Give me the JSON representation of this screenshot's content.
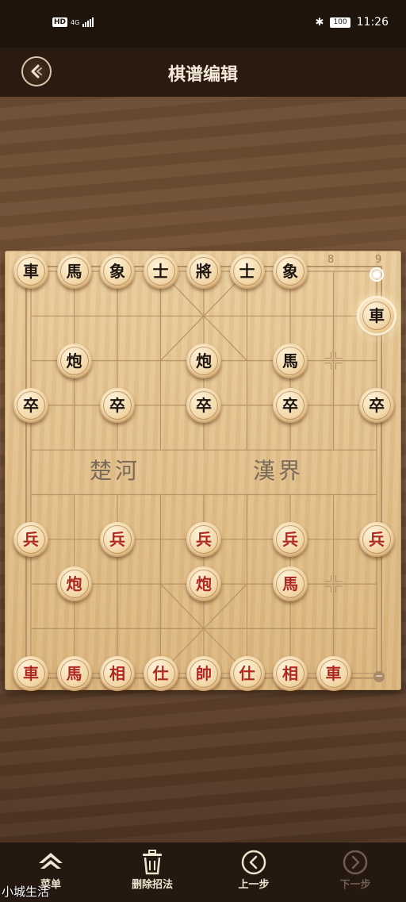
{
  "status_bar": {
    "hd": "HD",
    "network": "4G",
    "battery": "100",
    "time": "11:26"
  },
  "header": {
    "title": "棋谱编辑"
  },
  "board": {
    "file_labels": [
      "8",
      "9"
    ],
    "river_left": "楚河",
    "river_right": "漢界",
    "pieces": [
      {
        "t": "車",
        "side": "black",
        "col": 0,
        "row": 0
      },
      {
        "t": "馬",
        "side": "black",
        "col": 1,
        "row": 0
      },
      {
        "t": "象",
        "side": "black",
        "col": 2,
        "row": 0
      },
      {
        "t": "士",
        "side": "black",
        "col": 3,
        "row": 0
      },
      {
        "t": "將",
        "side": "black",
        "col": 4,
        "row": 0
      },
      {
        "t": "士",
        "side": "black",
        "col": 5,
        "row": 0
      },
      {
        "t": "象",
        "side": "black",
        "col": 6,
        "row": 0
      },
      {
        "t": "車",
        "side": "black",
        "col": 8,
        "row": 1,
        "selected": true
      },
      {
        "t": "炮",
        "side": "black",
        "col": 1,
        "row": 2
      },
      {
        "t": "炮",
        "side": "black",
        "col": 4,
        "row": 2
      },
      {
        "t": "馬",
        "side": "black",
        "col": 6,
        "row": 2
      },
      {
        "t": "卒",
        "side": "black",
        "col": 0,
        "row": 3
      },
      {
        "t": "卒",
        "side": "black",
        "col": 2,
        "row": 3
      },
      {
        "t": "卒",
        "side": "black",
        "col": 4,
        "row": 3
      },
      {
        "t": "卒",
        "side": "black",
        "col": 6,
        "row": 3
      },
      {
        "t": "卒",
        "side": "black",
        "col": 8,
        "row": 3
      },
      {
        "t": "兵",
        "side": "red",
        "col": 0,
        "row": 6
      },
      {
        "t": "兵",
        "side": "red",
        "col": 2,
        "row": 6
      },
      {
        "t": "兵",
        "side": "red",
        "col": 4,
        "row": 6
      },
      {
        "t": "兵",
        "side": "red",
        "col": 6,
        "row": 6
      },
      {
        "t": "兵",
        "side": "red",
        "col": 8,
        "row": 6
      },
      {
        "t": "炮",
        "side": "red",
        "col": 1,
        "row": 7
      },
      {
        "t": "炮",
        "side": "red",
        "col": 4,
        "row": 7
      },
      {
        "t": "馬",
        "side": "red",
        "col": 6,
        "row": 7
      },
      {
        "t": "車",
        "side": "red",
        "col": 0,
        "row": 9
      },
      {
        "t": "馬",
        "side": "red",
        "col": 1,
        "row": 9
      },
      {
        "t": "相",
        "side": "red",
        "col": 2,
        "row": 9
      },
      {
        "t": "仕",
        "side": "red",
        "col": 3,
        "row": 9
      },
      {
        "t": "帥",
        "side": "red",
        "col": 4,
        "row": 9
      },
      {
        "t": "仕",
        "side": "red",
        "col": 5,
        "row": 9
      },
      {
        "t": "相",
        "side": "red",
        "col": 6,
        "row": 9
      },
      {
        "t": "車",
        "side": "red",
        "col": 7,
        "row": 9
      }
    ],
    "last_move_from": {
      "col": 8,
      "row": 0
    }
  },
  "toolbar": {
    "menu": "菜单",
    "delete": "删除招法",
    "prev": "上一步",
    "next": "下一步"
  },
  "watermark": "小城生活",
  "colors": {
    "red_piece": "#b0281f",
    "black_piece": "#1f1610",
    "board": "#e2c08b"
  }
}
